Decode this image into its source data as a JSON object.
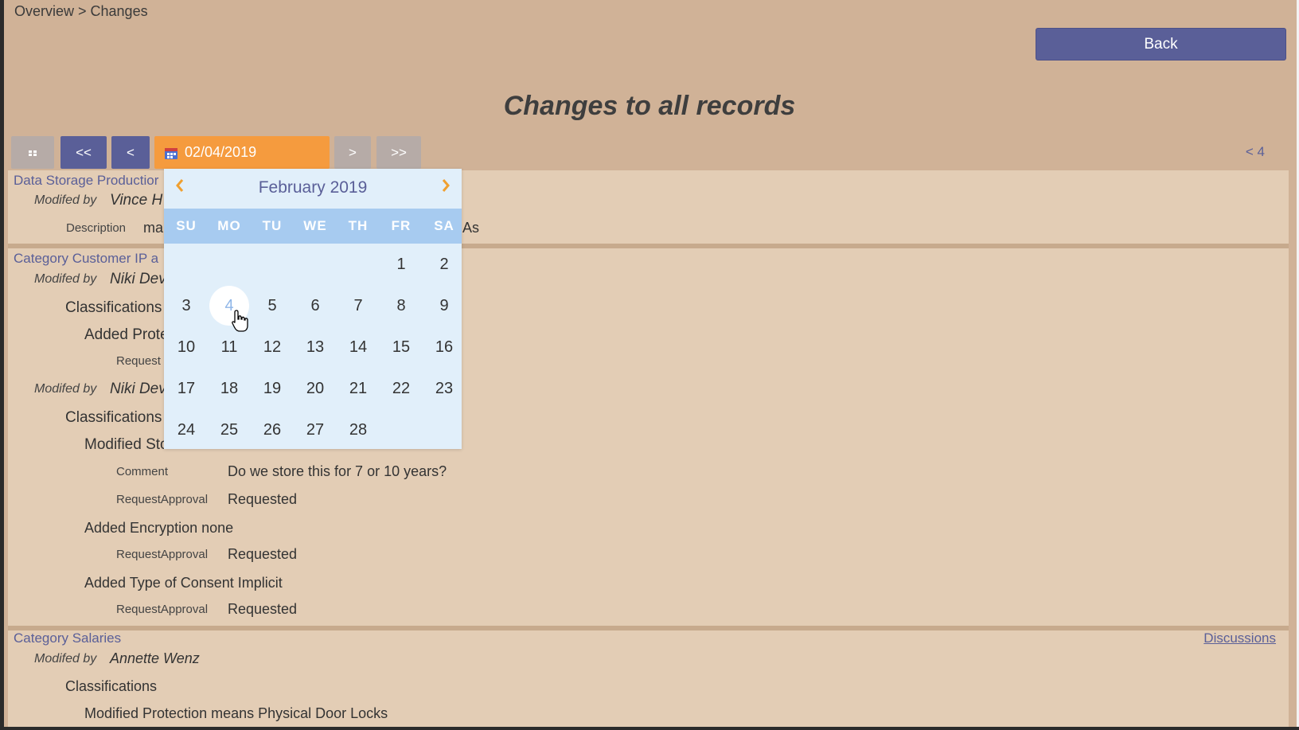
{
  "breadcrumb": "Overview > Changes",
  "back_label": "Back",
  "title": "Changes to all records",
  "toolbar": {
    "first_label": "<<",
    "prev_label": "<",
    "date_value": "02/04/2019",
    "next_label": ">",
    "last_label": ">>",
    "page_indicator": "<  4"
  },
  "records": [
    {
      "title": "Data Storage Productior",
      "modified_by_label": "Modifed by",
      "modified_by": "Vince H",
      "description_label": "Description",
      "description_start": "ma",
      "description_end": "As"
    },
    {
      "title": "Category Customer IP a",
      "changes": [
        {
          "modified_by_label": "Modifed by",
          "modified_by": "Niki Dev",
          "classifications_label": "Classifications",
          "action": "Added Prote",
          "request_label": "Request"
        },
        {
          "modified_by_label": "Modifed by",
          "modified_by": "Niki Dev",
          "classifications_label": "Classifications",
          "action": "Modified Sto",
          "comment_label": "Comment",
          "comment": "Do we store this for 7 or 10 years?",
          "request_label": "RequestApproval",
          "request_value": "Requested",
          "action2": "Added Encryption none",
          "request2_label": "RequestApproval",
          "request2_value": "Requested",
          "action3": "Added Type of Consent Implicit",
          "request3_label": "RequestApproval",
          "request3_value": "Requested"
        }
      ]
    },
    {
      "title": "Category Salaries",
      "link": "Discussions",
      "modified_by_label": "Modifed by",
      "modified_by": "Annette Wenz",
      "classifications_label": "Classifications",
      "action": "Modified Protection means Physical Door Locks"
    }
  ],
  "calendar": {
    "month_label": "February 2019",
    "prev": "‹",
    "next": "›",
    "weekdays": [
      "SU",
      "MO",
      "TU",
      "WE",
      "TH",
      "FR",
      "SA"
    ],
    "first_weekday": 5,
    "days_in_month": 28,
    "selected_day": 4
  },
  "icons": {
    "calendar": "calendar-icon",
    "grid": "grid-icon",
    "pointer": "hand-pointer-icon"
  },
  "colors": {
    "background": "#d0b297",
    "panel": "#e3cdb5",
    "accent_blue": "#5a5f98",
    "date_orange": "#f59b3e",
    "calendar_bg": "#e1effa",
    "calendar_header": "#a7cbf0"
  }
}
